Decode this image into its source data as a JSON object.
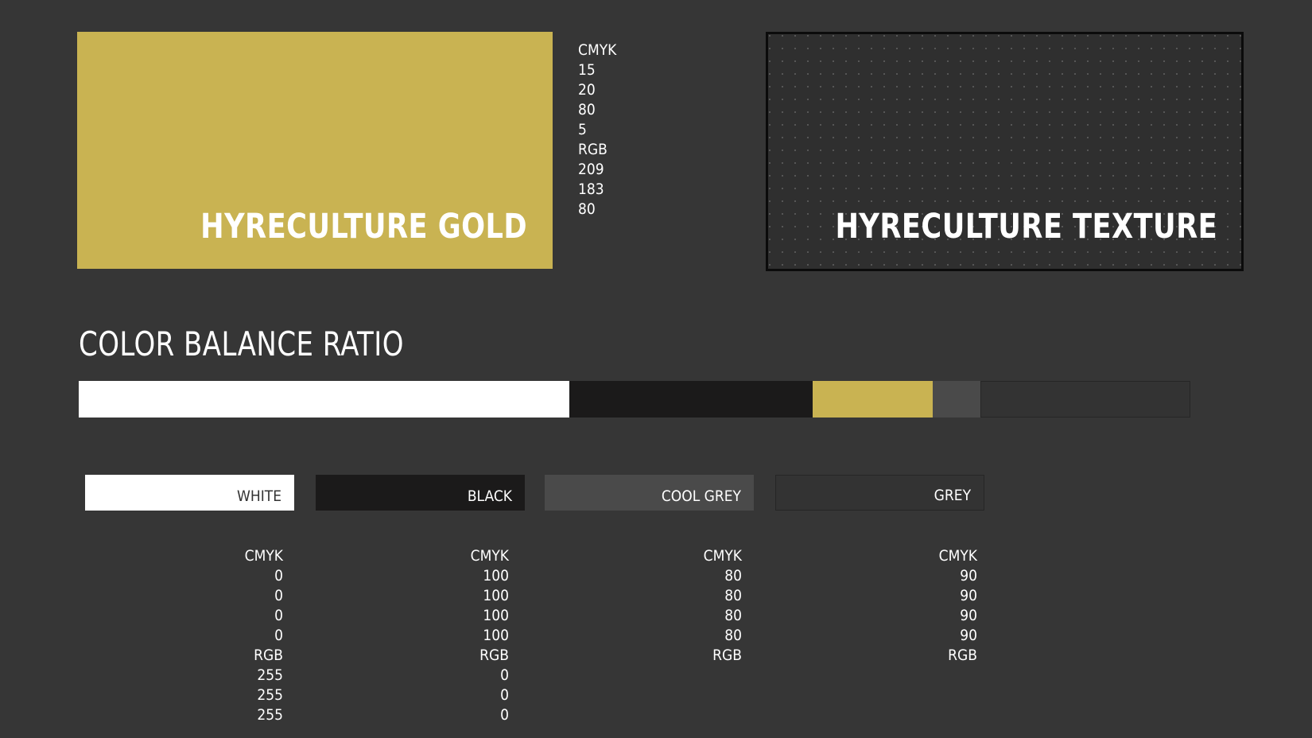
{
  "gold": {
    "title": "HYRECULTURE GOLD",
    "color": "#c9b352",
    "values": [
      "CMYK",
      "15",
      "20",
      "80",
      "5",
      "RGB",
      "209",
      "183",
      "80"
    ]
  },
  "texture": {
    "title": "HYRECULTURE TEXTURE",
    "color": "#2f2f2f"
  },
  "ratio": {
    "heading": "COLOR BALANCE RATIO",
    "segments": [
      {
        "name": "white",
        "color": "#ffffff",
        "share": 0.441
      },
      {
        "name": "black",
        "color": "#1b1a1a",
        "share": 0.219
      },
      {
        "name": "gold",
        "color": "#c9b352",
        "share": 0.108
      },
      {
        "name": "cool-grey",
        "color": "#4a4a4a",
        "share": 0.043
      },
      {
        "name": "grey",
        "color": "#333333",
        "share": 0.189
      }
    ]
  },
  "swatches": [
    {
      "label": "WHITE",
      "color": "#ffffff",
      "text_color": "#333333",
      "values": [
        "CMYK",
        "0",
        "0",
        "0",
        "0",
        "RGB",
        "255",
        "255",
        "255"
      ]
    },
    {
      "label": "BLACK",
      "color": "#1b1a1a",
      "text_color": "#ffffff",
      "values": [
        "CMYK",
        "100",
        "100",
        "100",
        "100",
        "RGB",
        "0",
        "0",
        "0"
      ]
    },
    {
      "label": "COOL GREY",
      "color": "#4a4a4a",
      "text_color": "#ffffff",
      "values": [
        "CMYK",
        "80",
        "80",
        "80",
        "80",
        "RGB"
      ]
    },
    {
      "label": "GREY",
      "color": "#333333",
      "text_color": "#ffffff",
      "values": [
        "CMYK",
        "90",
        "90",
        "90",
        "90",
        "RGB"
      ]
    }
  ]
}
